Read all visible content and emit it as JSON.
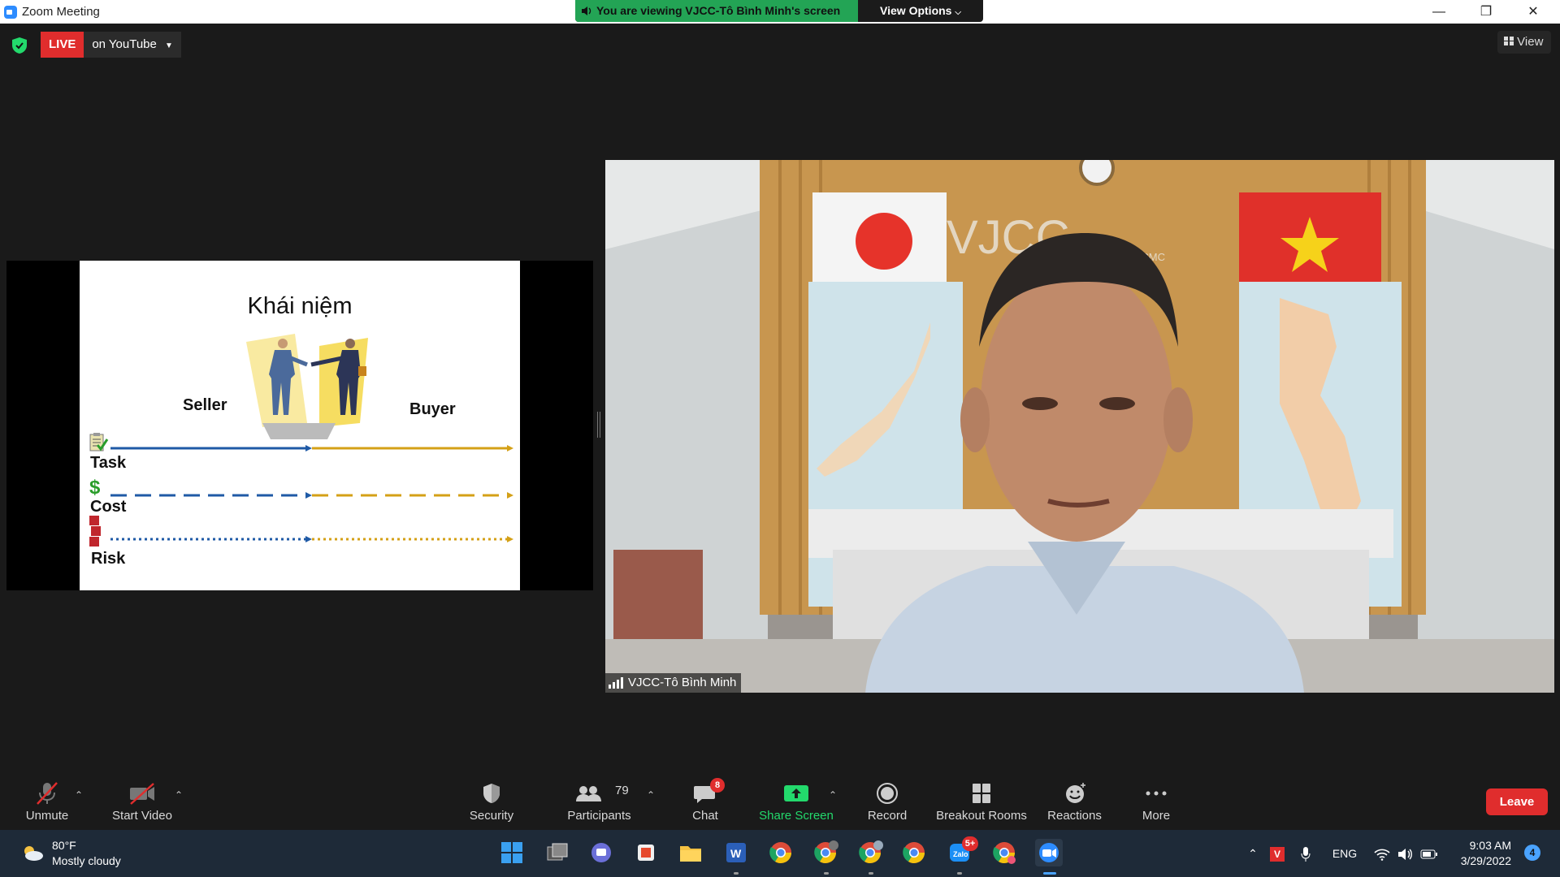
{
  "window": {
    "title": "Zoom Meeting"
  },
  "banner": {
    "viewing_text": "You are viewing VJCC-Tô Bình Minh's screen",
    "view_options": "View Options"
  },
  "window_controls": {
    "minimize": "—",
    "restore": "❐",
    "close": "✕"
  },
  "live": {
    "badge": "LIVE",
    "destination": "on YouTube"
  },
  "view_button": "View",
  "slide": {
    "title": "Khái niệm",
    "seller": "Seller",
    "buyer": "Buyer",
    "rows": [
      "Task",
      "Cost",
      "Risk"
    ],
    "cost_icon": "$"
  },
  "video": {
    "participant_name": "VJCC-Tô Bình Minh",
    "wall_logo": "VJCC",
    "wall_sub": "HCMC"
  },
  "toolbar": {
    "unmute": "Unmute",
    "start_video": "Start Video",
    "security": "Security",
    "participants": "Participants",
    "participants_count": "79",
    "chat": "Chat",
    "chat_badge": "8",
    "share_screen": "Share Screen",
    "record": "Record",
    "breakout_rooms": "Breakout Rooms",
    "reactions": "Reactions",
    "more": "More",
    "leave": "Leave"
  },
  "taskbar": {
    "weather_temp": "80°F",
    "weather_desc": "Mostly cloudy",
    "language": "ENG",
    "time": "9:03 AM",
    "date": "3/29/2022",
    "notifications": "4",
    "teams_badge": "5+",
    "apps": [
      "windows-start",
      "task-view",
      "teams-chat",
      "office",
      "file-explorer",
      "word",
      "chrome-1",
      "chrome-2",
      "chrome-3",
      "chrome-4",
      "zalo",
      "chrome-5",
      "zoom"
    ]
  },
  "colors": {
    "zoom_blue": "#2d8cff",
    "live_red": "#e02d2d",
    "share_green": "#23d96c",
    "banner_green": "#23a455"
  }
}
